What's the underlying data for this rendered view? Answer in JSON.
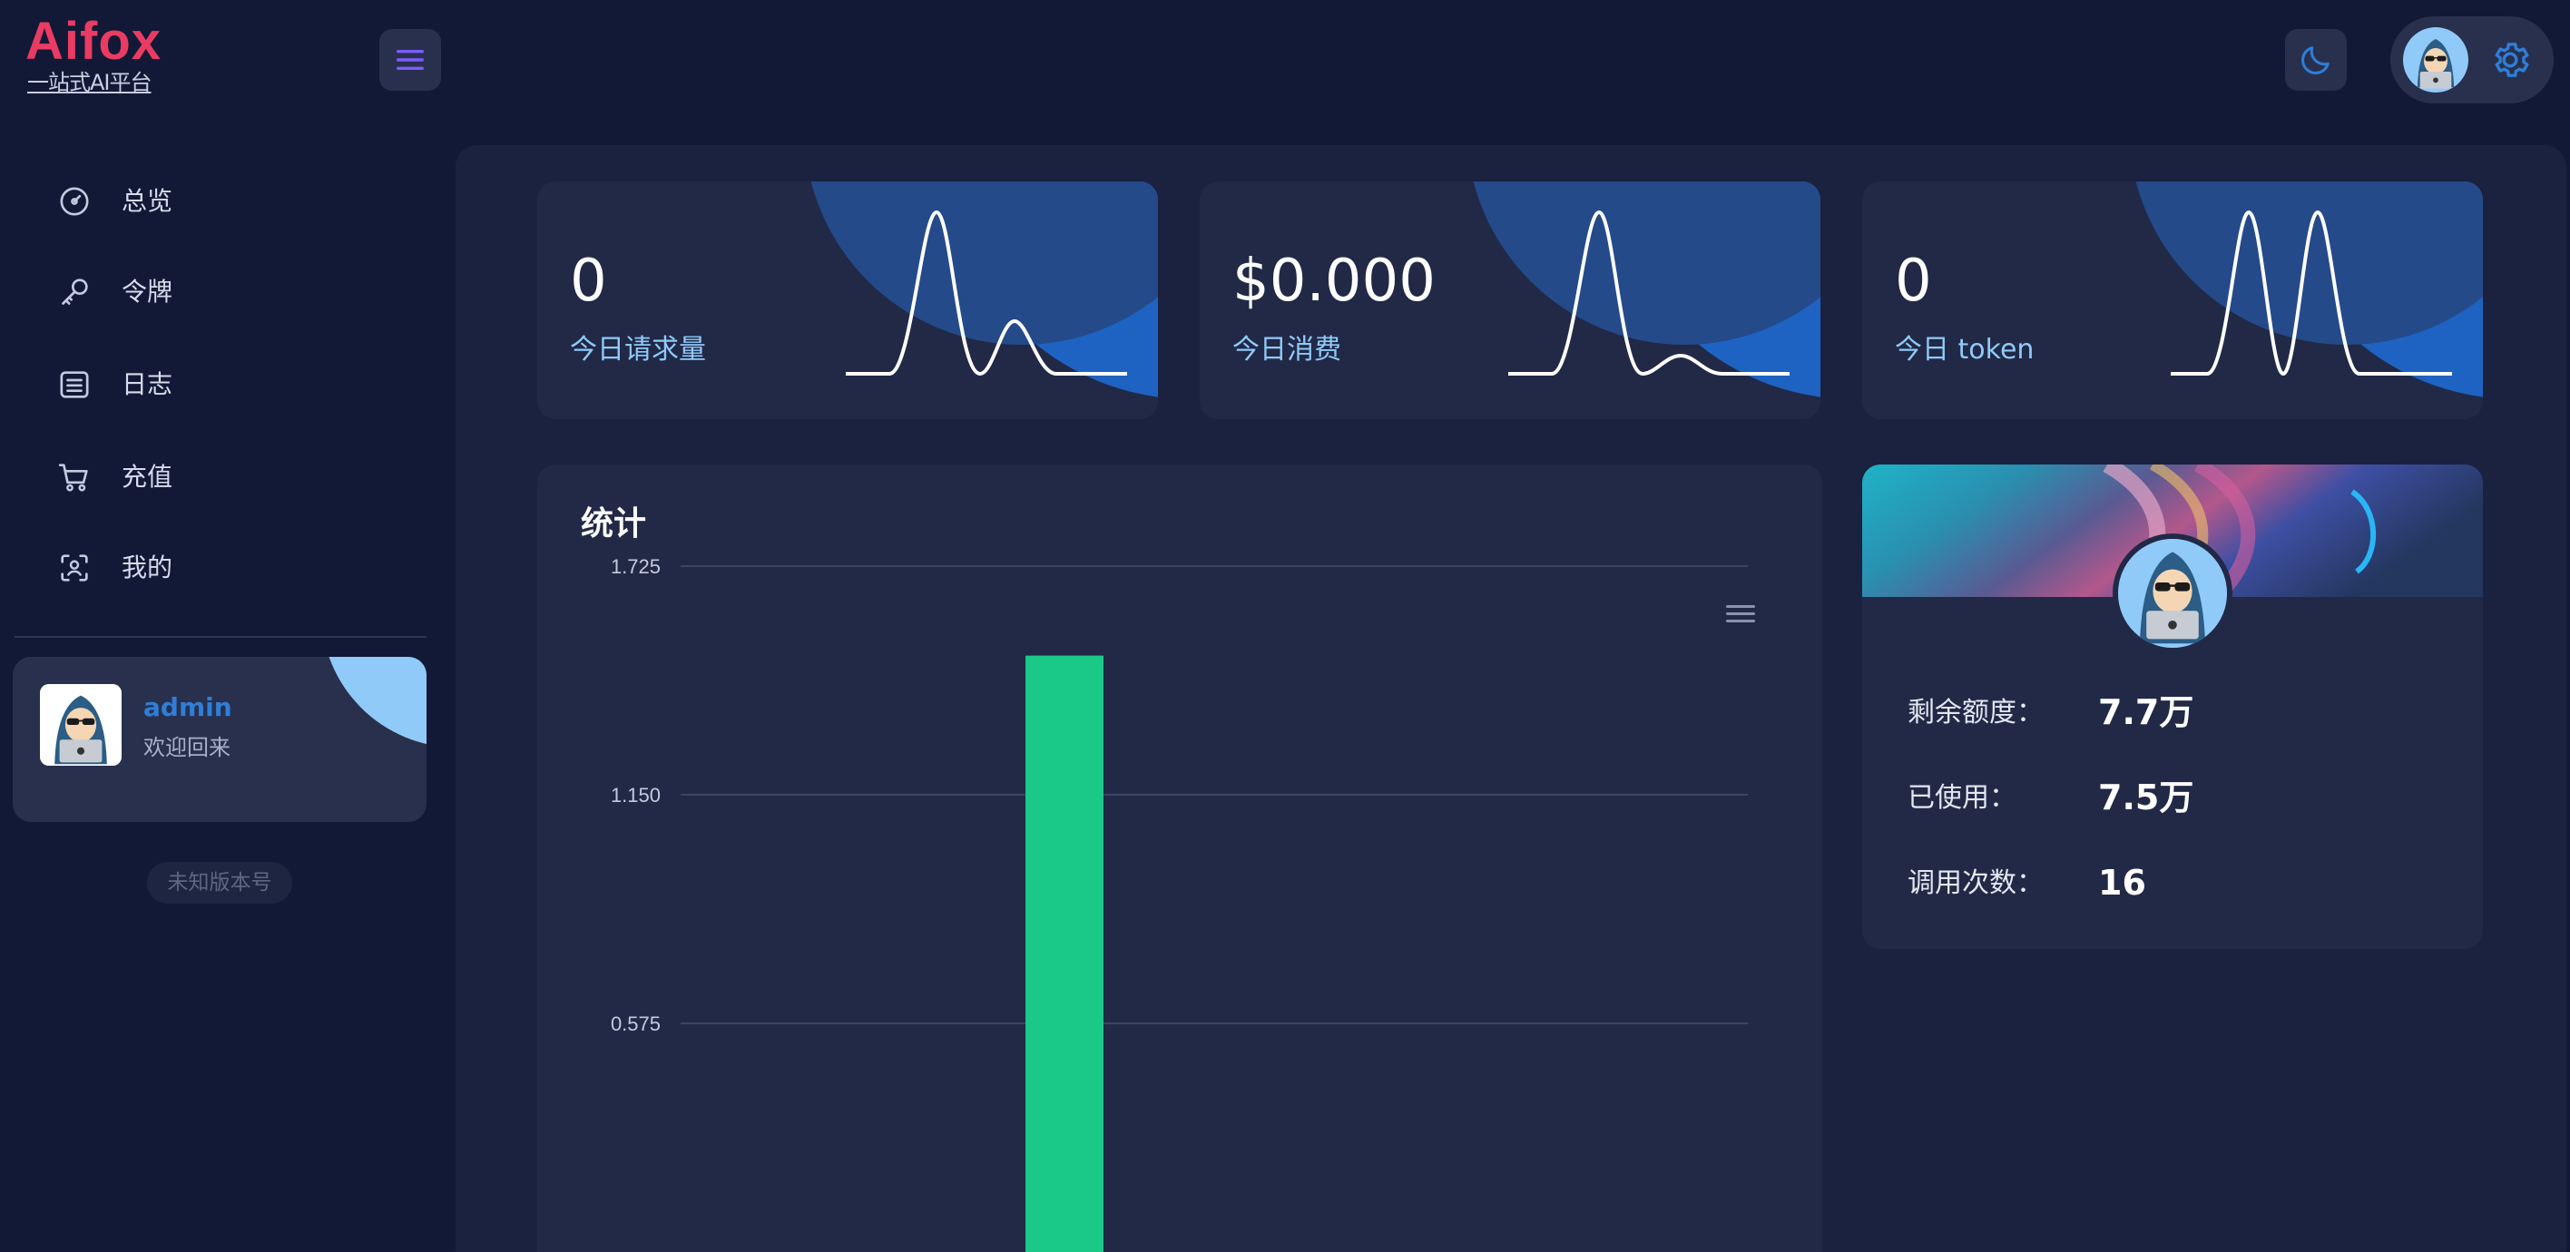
{
  "brand": {
    "name": "Aifox",
    "tagline": "一站式AI平台",
    "accent_color": "#ea3b63"
  },
  "header": {
    "menu_icon": "hamburger-icon",
    "theme_icon": "moon-icon",
    "settings_icon": "gear-icon",
    "avatar_icon": "hacker-avatar-icon"
  },
  "sidebar": {
    "items": [
      {
        "label": "总览",
        "icon": "dashboard-gauge-icon"
      },
      {
        "label": "令牌",
        "icon": "key-icon"
      },
      {
        "label": "日志",
        "icon": "list-icon"
      },
      {
        "label": "充值",
        "icon": "cart-icon"
      },
      {
        "label": "我的",
        "icon": "user-scan-icon"
      }
    ],
    "user": {
      "name": "admin",
      "welcome": "欢迎回来"
    },
    "version": "未知版本号"
  },
  "stats": [
    {
      "value": "0",
      "label": "今日请求量"
    },
    {
      "value": "$0.000",
      "label": "今日消费"
    },
    {
      "value": "0",
      "label": "今日 token"
    }
  ],
  "chart": {
    "title": "统计",
    "menu_icon": "menu-lines-icon"
  },
  "chart_data": {
    "type": "bar",
    "title": "统计",
    "xlabel": "",
    "ylabel": "",
    "y_ticks": [
      "1.725",
      "1.150",
      "0.575"
    ],
    "ylim": [
      0,
      1.725
    ],
    "categories": [
      ""
    ],
    "values": [
      1.5
    ],
    "bar_color": "#1ac888",
    "grid": true
  },
  "profile": {
    "rows": [
      {
        "label": "剩余额度：",
        "value": "7.7万"
      },
      {
        "label": "已使用：",
        "value": "7.5万"
      },
      {
        "label": "调用次数：",
        "value": "16"
      }
    ]
  }
}
